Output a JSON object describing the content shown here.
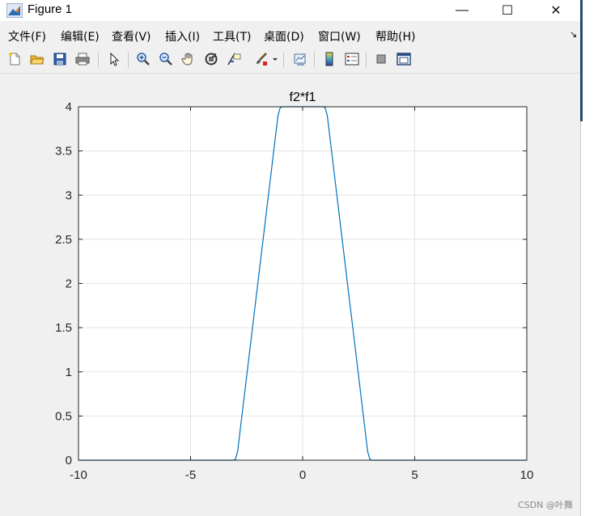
{
  "window": {
    "title": "Figure 1",
    "icon": "matlab-logo-icon",
    "controls": {
      "minimize": "—",
      "maximize": "☐",
      "close": "✕"
    }
  },
  "menu": [
    {
      "id": "file",
      "label": "文件(F)"
    },
    {
      "id": "edit",
      "label": "编辑(E)"
    },
    {
      "id": "view",
      "label": "查看(V)"
    },
    {
      "id": "insert",
      "label": "插入(I)"
    },
    {
      "id": "tools",
      "label": "工具(T)"
    },
    {
      "id": "desktop",
      "label": "桌面(D)"
    },
    {
      "id": "window",
      "label": "窗口(W)"
    },
    {
      "id": "help",
      "label": "帮助(H)"
    }
  ],
  "dock_arrow": "↘",
  "toolbar": [
    "new-figure-icon",
    "open-file-icon",
    "save-icon",
    "print-icon",
    "edit-plot-arrow-icon",
    "zoom-in-icon",
    "zoom-out-icon",
    "pan-hand-icon",
    "rotate-3d-icon",
    "data-cursor-icon",
    "brush-icon",
    "brush-dropdown-icon",
    "link-plot-icon",
    "insert-colorbar-icon",
    "insert-legend-icon",
    "hide-plot-tools-icon",
    "show-plot-tools-icon"
  ],
  "chart_data": {
    "type": "line",
    "title": "f2*f1",
    "xlabel": "",
    "ylabel": "",
    "xlim": [
      -10,
      10
    ],
    "ylim": [
      0,
      4
    ],
    "xticks": [
      "-10",
      "-5",
      "0",
      "5",
      "10"
    ],
    "yticks": [
      "0",
      "0.5",
      "1",
      "1.5",
      "2",
      "2.5",
      "3",
      "3.5",
      "4"
    ],
    "grid": true,
    "series": [
      {
        "color": "#0072bd",
        "x": [
          -10,
          -3.1,
          -3.0,
          -2.9,
          -2.0,
          -1.1,
          -1.0,
          -0.9,
          0,
          0.9,
          1.0,
          1.1,
          2.0,
          2.9,
          3.0,
          3.1,
          10
        ],
        "y": [
          0,
          0,
          0.01,
          0.1,
          2.0,
          3.9,
          3.99,
          4.0,
          4.0,
          4.0,
          3.99,
          3.9,
          2.0,
          0.1,
          0.01,
          0,
          0
        ]
      }
    ]
  },
  "watermark": "CSDN @叶舞"
}
